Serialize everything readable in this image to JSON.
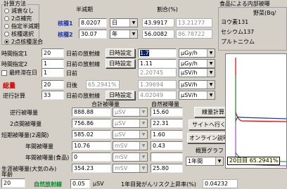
{
  "calc_method": {
    "title": "計算方法",
    "options": [
      "減衰なし",
      "2点補完",
      "指定半減期",
      "核種選択",
      "2点核種混合"
    ],
    "selected": 4
  },
  "nuclide": {
    "half_life_header": "半減期",
    "ratio_header": "割合(%)",
    "rows": [
      {
        "label": "核種1",
        "half_life": "8.0207",
        "unit": "日",
        "ratio": "43.9917",
        "ratio2": "13.21277"
      },
      {
        "label": "核種2",
        "half_life": "30.07",
        "unit": "年",
        "ratio": "56.0082",
        "ratio2": "86.78722"
      }
    ]
  },
  "food": {
    "title": "食品による内部被曝",
    "header": "野菜(Bq/",
    "rows": [
      "ヨウ素131",
      "セシウム137",
      "プルトニウム"
    ]
  },
  "time": {
    "rows": [
      {
        "label": "時間指定1",
        "value": "20",
        "mid": "日前の放射線",
        "btn": "日時設定",
        "dose": "1.7",
        "unit": "μGy/h"
      },
      {
        "label": "時間指定2",
        "value": "1",
        "mid": "日前の放射線",
        "btn": "日時設定",
        "dose": "1.11",
        "unit": "μGy/h"
      }
    ],
    "max_label": "最終滞在日",
    "max_value": "1",
    "max_mid": "日前",
    "max_dose": "2.20745",
    "max_unit": "μSV/h"
  },
  "total": {
    "label": "総量",
    "value": "20",
    "mid": "日後",
    "percent": "65.2941%",
    "dose": "1.39694",
    "unit": "μSV/h"
  },
  "reverse": {
    "label": "逆行計算",
    "value": "33",
    "mid": "日前の放射線",
    "btn": "日時設定",
    "dose": "4.02049",
    "unit": "μSV/h"
  },
  "sums": {
    "header_total": "合計被曝量",
    "header_natural": "自然被曝量",
    "rows": [
      {
        "label": "逆行被曝量",
        "value": "888.88",
        "unit": "μSV",
        "nat": "15.60"
      },
      {
        "label": "2点間被曝量",
        "value": "756.86",
        "unit": "μSV",
        "nat": "22.31"
      },
      {
        "label": "短期被曝量(2週間)",
        "value": "585.02",
        "unit": "μSV",
        "nat": "1.60"
      },
      {
        "label": "年間被曝量",
        "value": "10.76",
        "unit": "mSV",
        "nat": "0.43"
      },
      {
        "label": "年間被曝量(食品)",
        "value": "0",
        "unit": "mSV",
        "nat": ""
      },
      {
        "label": "生涯被曝量(大気のみ)",
        "value": "354.23",
        "unit": "mSV",
        "nat": "25.80"
      }
    ]
  },
  "buttons": {
    "calc": "線量計算",
    "site": "サイトへ行く",
    "manual": "オンライン説明書",
    "graph_label": "概算グラフ",
    "graph_select": "1年間"
  },
  "age": {
    "label": "年齢",
    "value": "20"
  },
  "natural": {
    "label": "自然放射線",
    "value": "0.05",
    "unit": "μSV"
  },
  "risk": {
    "label": "1年目発がんリスク上昇率(%)",
    "value": "0.04232"
  },
  "graph": {
    "tooltip": "20日目 65.2941%",
    "colors": {
      "red": "#e00000",
      "blue": "#1a33b8",
      "green": "#0a8a2a",
      "purple": "#8a2ad0"
    }
  }
}
